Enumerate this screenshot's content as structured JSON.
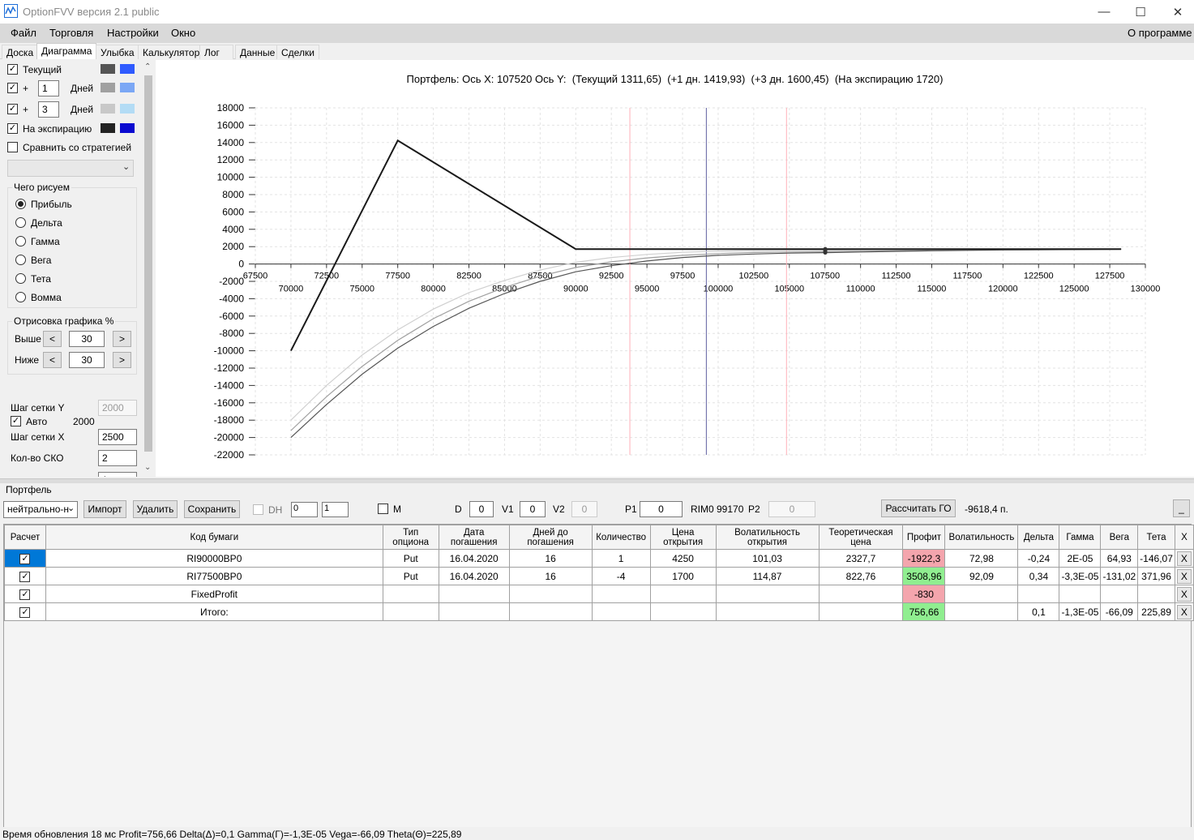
{
  "window": {
    "title": "OptionFVV версия 2.1 public",
    "minimize": "—",
    "maximize": "☐",
    "close": "✕"
  },
  "menu": {
    "items": [
      "Файл",
      "Торговля",
      "Настройки",
      "Окно"
    ],
    "about": "О программе"
  },
  "tabs": [
    "Доска",
    "Диаграмма",
    "Улыбка",
    "Калькулятор",
    "Лог",
    "Данные",
    "Сделки"
  ],
  "left_panel": {
    "current_label": "Текущий",
    "plus1_sign": "+",
    "plus1_value": "1",
    "plus1_unit": "Дней",
    "plus3_sign": "+",
    "plus3_value": "3",
    "plus3_unit": "Дней",
    "expiry_label": "На экспирацию",
    "compare_label": "Сравнить со стратегией",
    "what_group": "Чего рисуем",
    "radios": [
      "Прибыль",
      "Дельта",
      "Гамма",
      "Вега",
      "Тета",
      "Вомма"
    ],
    "selected_radio": "Прибыль",
    "draw_group": "Отрисовка графика %",
    "above_label": "Выше",
    "above_value": "30",
    "below_label": "Ниже",
    "below_value": "30",
    "dec": "<",
    "inc": ">",
    "grid_y_label": "Шаг сетки Y",
    "grid_y_value": "2000",
    "auto_label": "Авто",
    "auto_value": "2000",
    "grid_x_label": "Шаг сетки X",
    "grid_x_value": "2500",
    "sko_label": "Кол-во СКО",
    "sko_value": "2",
    "cut_value": "1",
    "colors": {
      "current": [
        "#555555",
        "#2f5bff"
      ],
      "plus1": [
        "#a0a0a0",
        "#7ba7f5"
      ],
      "plus3": [
        "#c8c8c8",
        "#b3dcf5"
      ],
      "expiry": [
        "#222222",
        "#0a0ad0"
      ]
    }
  },
  "chart_data": {
    "type": "line",
    "title": "Портфель: Ось X: 107520 Ось Y:  (Текущий 1311,65)  (+1 дн. 1419,93)  (+3 дн. 1600,45)  (На экспирацию 1720)",
    "ylim": [
      -22000,
      18000
    ],
    "xlim": [
      67500,
      130000
    ],
    "yticks": [
      18000,
      16000,
      14000,
      12000,
      10000,
      8000,
      6000,
      4000,
      2000,
      0,
      -2000,
      -4000,
      -6000,
      -8000,
      -10000,
      -12000,
      -14000,
      -16000,
      -18000,
      -20000,
      -22000
    ],
    "xticks_top": [
      67500,
      72500,
      77500,
      82500,
      87500,
      92500,
      97500,
      102500,
      107500,
      112500,
      117500,
      122500,
      127500
    ],
    "xticks_bottom": [
      70000,
      75000,
      80000,
      85000,
      90000,
      95000,
      100000,
      105000,
      110000,
      115000,
      120000,
      125000,
      130000
    ],
    "vlines": [
      {
        "x": 93800,
        "color": "#ffb0b8"
      },
      {
        "x": 99170,
        "color": "#6060a0"
      },
      {
        "x": 104800,
        "color": "#ffb0b8"
      }
    ],
    "marker_x": 107520,
    "series": [
      {
        "key": "expiry",
        "color": "#1a1a1a",
        "x": [
          70000,
          77500,
          90000,
          128300
        ],
        "y": [
          -10000,
          14230,
          1720,
          1720
        ]
      },
      {
        "key": "current",
        "color": "#555555",
        "x": [
          70000,
          72500,
          75000,
          77500,
          80000,
          82500,
          85000,
          87500,
          90000,
          92500,
          95000,
          97500,
          100000,
          102500,
          105000,
          107520,
          110000,
          115000,
          120000,
          128300
        ],
        "y": [
          -20000,
          -16200,
          -12700,
          -9700,
          -7200,
          -5100,
          -3400,
          -2000,
          -900,
          -200,
          350,
          750,
          1000,
          1150,
          1250,
          1312,
          1380,
          1520,
          1620,
          1700
        ]
      },
      {
        "key": "plus1",
        "color": "#a0a0a0",
        "x": [
          70000,
          72500,
          75000,
          77500,
          80000,
          82500,
          85000,
          87500,
          90000,
          92500,
          95000,
          97500,
          100000,
          102500,
          105000,
          107520,
          110000,
          115000,
          120000,
          128300
        ],
        "y": [
          -19200,
          -15300,
          -11800,
          -8800,
          -6300,
          -4300,
          -2700,
          -1400,
          -400,
          250,
          700,
          1000,
          1200,
          1330,
          1380,
          1420,
          1480,
          1580,
          1650,
          1710
        ]
      },
      {
        "key": "plus3",
        "color": "#d0d0d0",
        "x": [
          70000,
          72500,
          75000,
          77500,
          80000,
          82500,
          85000,
          87500,
          90000,
          92500,
          95000,
          97500,
          100000,
          102500,
          105000,
          107520,
          110000,
          115000,
          120000,
          128300
        ],
        "y": [
          -18000,
          -14000,
          -10500,
          -7600,
          -5200,
          -3300,
          -1900,
          -700,
          200,
          750,
          1100,
          1350,
          1480,
          1550,
          1580,
          1600,
          1630,
          1670,
          1700,
          1715
        ]
      }
    ]
  },
  "portfolio": {
    "title": "Портфель",
    "strategy": "нейтрально-н",
    "import_btn": "Импорт",
    "delete_btn": "Удалить",
    "save_btn": "Сохранить",
    "dh_label": "DH",
    "dh_num1": "0",
    "dh_num2": "1",
    "m_label": "M",
    "d_label": "D",
    "d_value": "0",
    "v1_label": "V1",
    "v1_value": "0",
    "v2_label": "V2",
    "v2_value": "0",
    "p1_label": "P1",
    "p1_value": "0",
    "rim_label": "RIM0 99170",
    "p2_label": "P2",
    "p2_value": "0",
    "calc_btn": "Рассчитать ГО",
    "go_value": "-9618,4 п.",
    "collapse_btn": "_"
  },
  "table": {
    "headers": [
      "Расчет",
      "Код бумаги",
      "Тип опциона",
      "Дата погашения",
      "Дней до погашения",
      "Количество",
      "Цена открытия",
      "Волатильность открытия",
      "Теоретическая цена",
      "Профит",
      "Волатильность",
      "Дельта",
      "Гамма",
      "Вега",
      "Тета",
      "X"
    ],
    "rows": [
      [
        "✓",
        "RI90000BP0",
        "Put",
        "16.04.2020",
        "16",
        "1",
        "4250",
        "101,03",
        "2327,7",
        "-1922,3",
        "72,98",
        "-0,24",
        "2E-05",
        "64,93",
        "-146,07",
        "X"
      ],
      [
        "✓",
        "RI77500BP0",
        "Put",
        "16.04.2020",
        "16",
        "-4",
        "1700",
        "114,87",
        "822,76",
        "3508,96",
        "92,09",
        "0,34",
        "-3,3E-05",
        "-131,02",
        "371,96",
        "X"
      ],
      [
        "✓",
        "FixedProfit",
        "",
        "",
        "",
        "",
        "",
        "",
        "",
        "-830",
        "",
        "",
        "",
        "",
        "",
        "X"
      ],
      [
        "✓",
        "Итого:",
        "",
        "",
        "",
        "",
        "",
        "",
        "",
        "756,66",
        "",
        "0,1",
        "-1,3E-05",
        "-66,09",
        "225,89",
        "X"
      ]
    ]
  },
  "status": "Время обновления 18 мс  Profit=756,66 Delta(Δ)=0,1 Gamma(Γ)=-1,3E-05 Vega=-66,09 Theta(Θ)=225,89"
}
